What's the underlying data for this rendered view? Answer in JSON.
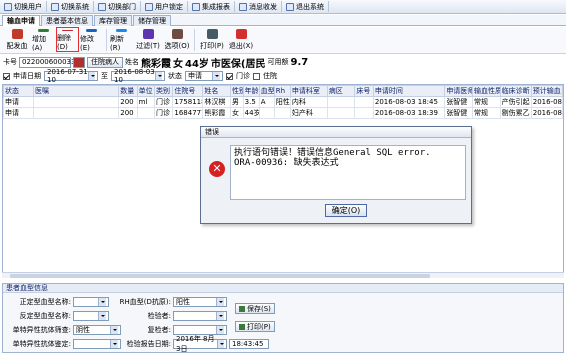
{
  "sysbar": [
    "切换用户",
    "切换系统",
    "切换部门",
    "用户锁定",
    "集成报表",
    "消息收发",
    "退出系统"
  ],
  "tabs": [
    {
      "label": "输血申请",
      "active": true
    },
    {
      "label": "患者基本信息",
      "active": false
    },
    {
      "label": "库存管理",
      "active": false
    },
    {
      "label": "储存管理",
      "active": false
    }
  ],
  "toolbar": [
    {
      "label": "配发血",
      "icon": "blood-bag-icon",
      "color": "#c0392b"
    },
    {
      "label": "增加(A)",
      "icon": "add-icon",
      "color": "#2e7d32"
    },
    {
      "label": "删除(D)",
      "icon": "delete-icon",
      "color": "#c62828"
    },
    {
      "label": "修改(E)",
      "icon": "edit-icon",
      "color": "#1565c0"
    },
    {
      "label": "刷新(R)",
      "icon": "refresh-icon",
      "color": "#1e88e5"
    },
    {
      "label": "过滤(T)",
      "icon": "filter-icon",
      "color": "#5e35b1"
    },
    {
      "label": "选项(O)",
      "icon": "options-icon",
      "color": "#6d4c41"
    },
    {
      "label": "打印(P)",
      "icon": "print-icon",
      "color": "#455a64"
    },
    {
      "label": "退出(X)",
      "icon": "exit-icon",
      "color": "#d32f2f"
    }
  ],
  "patient": {
    "card_label": "卡号",
    "card_value": "0220006000331",
    "btn_label": "住院病人",
    "name_label": "姓名",
    "name": "熊彩霞",
    "sex": "女",
    "age": "44岁",
    "insurance": "市医保(居民",
    "balance_label": "可用额",
    "balance": "9.7"
  },
  "filter": {
    "date_label": "申请日期",
    "date_from": "2016-07-31 10",
    "to_label": "至",
    "date_to": "2016-08-03 10",
    "status_label": "状态",
    "status_value": "申请",
    "outpatient_label": "门诊",
    "inpatient_label": "住院"
  },
  "table": {
    "columns": [
      "状态",
      "医嘱",
      "数量",
      "单位",
      "类别",
      "住院号",
      "姓名",
      "性别",
      "年龄",
      "血型",
      "Rh",
      "申请科室",
      "病区",
      "床号",
      "申请时间",
      "申请医师",
      "输血性质",
      "临床诊断",
      "预计输血日"
    ],
    "rows": [
      [
        "申请",
        "",
        "200",
        "ml",
        "门诊",
        "1758118",
        "林汉棋",
        "男",
        "3.5",
        "A",
        "阳性",
        "内科",
        "",
        "",
        "2016-08-03 18:45",
        "张智健",
        "常规",
        "产伤引起",
        "2016-08"
      ],
      [
        "申请",
        "",
        "200",
        "",
        "门诊",
        "1684777",
        "熊彩霞",
        "女",
        "44岁",
        "",
        "",
        "妇产科",
        "",
        "",
        "2016-08-03 18:39",
        "张智健",
        "常规",
        "剔伤累乙",
        "2016-08"
      ]
    ]
  },
  "dialog": {
    "title": "错误",
    "line1": "执行语句错误！错误信息General SQL error.",
    "line2": "ORA-00936: 缺失表达式",
    "ok_label": "确定(O)"
  },
  "bottom": {
    "title": "患者血型信息",
    "f1_label": "正定型血型名称:",
    "f2_label": "反定型血型名称:",
    "f3_label": "单特异性抗体筛查:",
    "f3_value": "阴性",
    "f4_label": "单特异性抗体鉴定:",
    "rh_label": "RH血型(D抗原):",
    "rh_value": "阳性",
    "check_label": "检验者:",
    "review_label": "复检者:",
    "report_date_label": "检验报告日期:",
    "report_date": "2016年 8月 3日",
    "report_time": "18:43:45",
    "save_label": "保存(S)",
    "print_label": "打印(P)"
  }
}
